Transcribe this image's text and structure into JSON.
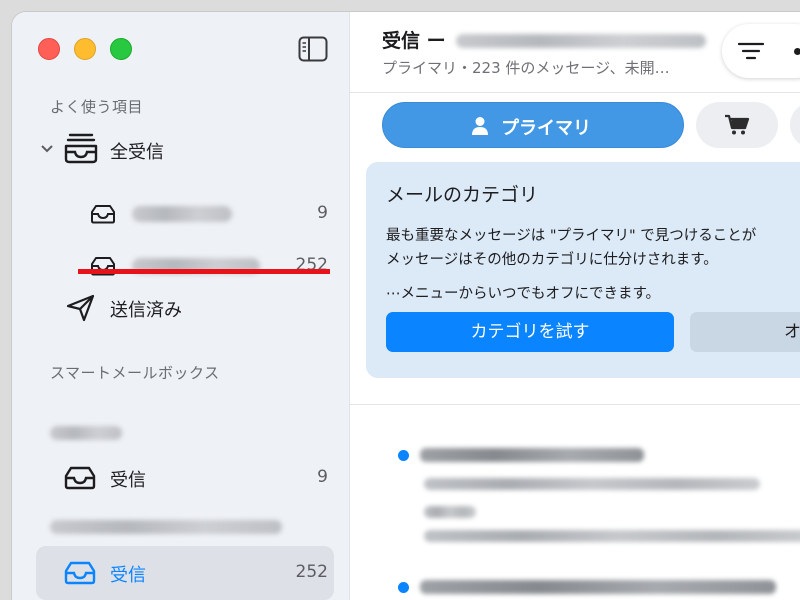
{
  "sidebar": {
    "favorites_header": "よく使う項目",
    "all_inboxes": "全受信",
    "account1_count": "9",
    "account2_count": "252",
    "sent": "送信済み",
    "smart_mailboxes_header": "スマートメールボックス",
    "inbox_a_label": "受信",
    "inbox_a_count": "9",
    "inbox_b_label": "受信",
    "inbox_b_count": "252"
  },
  "main": {
    "title": "受信 ー",
    "subtitle": "プライマリ・223 件のメッセージ、未開…",
    "tab_primary": "プライマリ",
    "card": {
      "title": "メールのカテゴリ",
      "line1": "最も重要なメッセージは \"プライマリ\" で見つけることが",
      "line2": "メッセージはその他のカテゴリに仕分けされます。",
      "line3": "⋯メニューからいつでもオフにできます。",
      "try_button": "カテゴリを試す",
      "off_button": "オ"
    }
  },
  "colors": {
    "accent": "#0a84ff",
    "tab_active": "#4398e6",
    "underline": "#e8121b"
  }
}
